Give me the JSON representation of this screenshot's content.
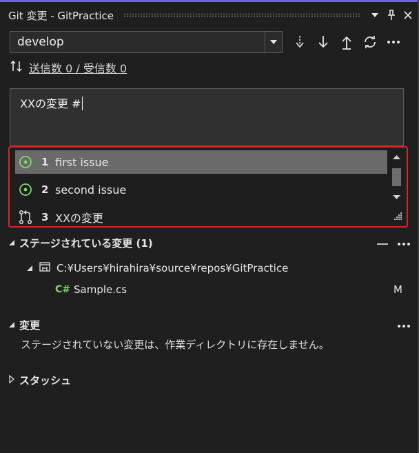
{
  "titlebar": {
    "title": "Git 変更 - GitPractice"
  },
  "branch": {
    "name": "develop"
  },
  "sync": {
    "label": "送信数 0 / 受信数 0"
  },
  "commit": {
    "message": "XXの変更 #"
  },
  "suggestions": {
    "items": [
      {
        "number": "1",
        "label": "first issue",
        "icon": "issue-open-icon",
        "selected": true
      },
      {
        "number": "2",
        "label": "second issue",
        "icon": "issue-open-icon",
        "selected": false
      },
      {
        "number": "3",
        "label": "XXの変更",
        "icon": "pull-request-icon",
        "selected": false
      }
    ]
  },
  "staged": {
    "title": "ステージされている変更 (1)",
    "repo_path": "C:¥Users¥hirahira¥source¥repos¥GitPractice",
    "file_badge": "C#",
    "file_name": "Sample.cs",
    "file_status": "M"
  },
  "changes": {
    "title": "変更",
    "empty_message": "ステージされていない変更は、作業ディレクトリに存在しません。"
  },
  "stash": {
    "title": "スタッシュ"
  },
  "colors": {
    "accent": "#7160e8",
    "highlight_border": "#d4252b",
    "issue_green": "#7fd96b",
    "background": "#1f1f1f"
  }
}
